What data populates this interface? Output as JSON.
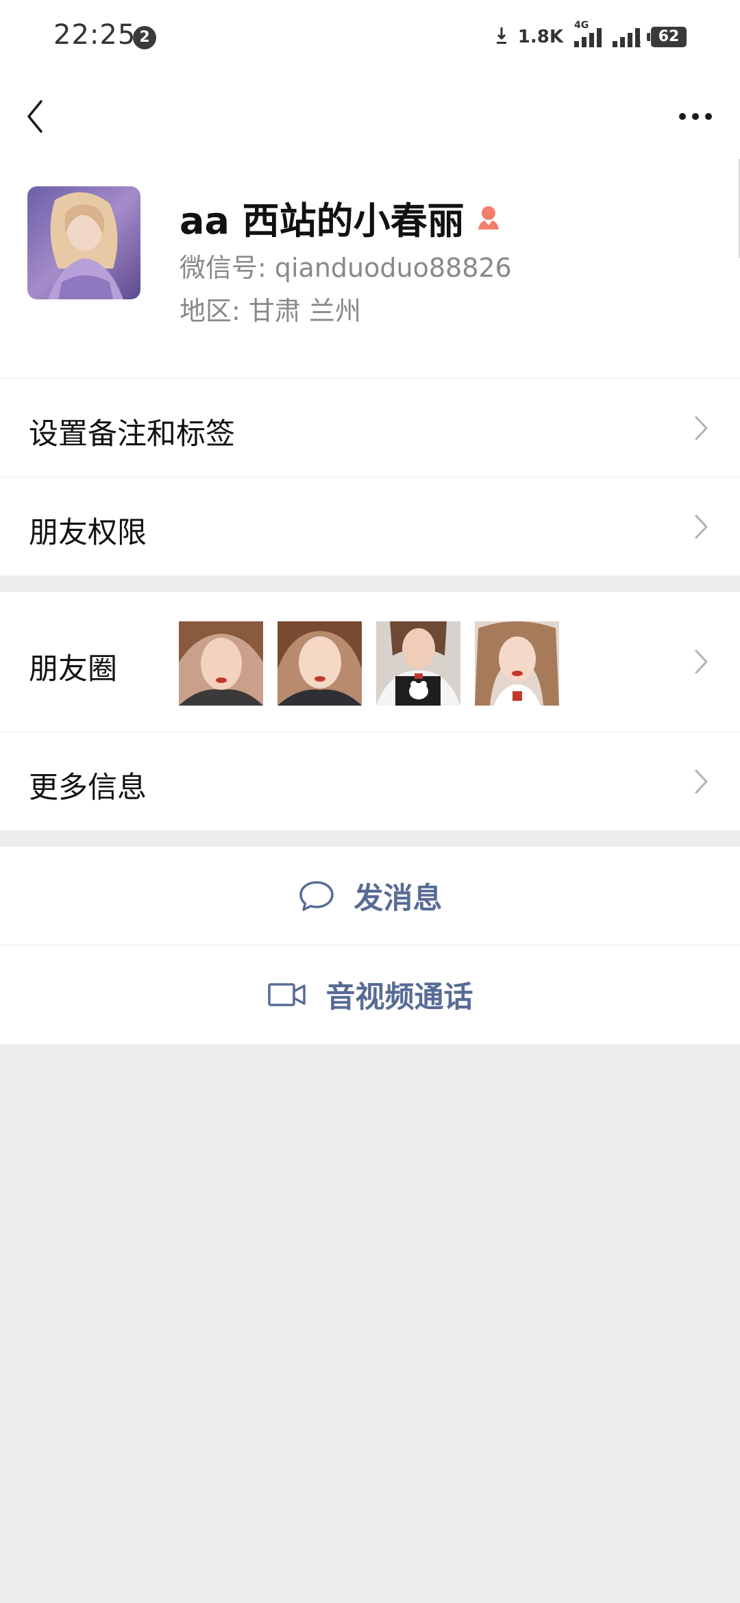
{
  "status_bar": {
    "time": "22:25",
    "notification_count": "2",
    "net_speed": "1.8K",
    "network_type": "4G",
    "sim2_label": "2",
    "battery": "62"
  },
  "nav": {
    "back_icon": "chevron-left-icon",
    "more_icon": "more-dots-icon"
  },
  "profile": {
    "name": "aa 西站的小春丽",
    "gender_icon": "female-icon",
    "gender_color": "#f37e6c",
    "wechat_id": "微信号: qianduoduo88826",
    "region": "地区: 甘肃  兰州"
  },
  "menu": {
    "remark_tags": "设置备注和标签",
    "friend_permissions": "朋友权限",
    "moments": "朋友圈",
    "more_info": "更多信息"
  },
  "actions": {
    "send_message": "发消息",
    "send_message_icon": "chat-bubble-icon",
    "video_call": "音视频通话",
    "video_call_icon": "video-camera-icon",
    "accent_color": "#576b95"
  }
}
